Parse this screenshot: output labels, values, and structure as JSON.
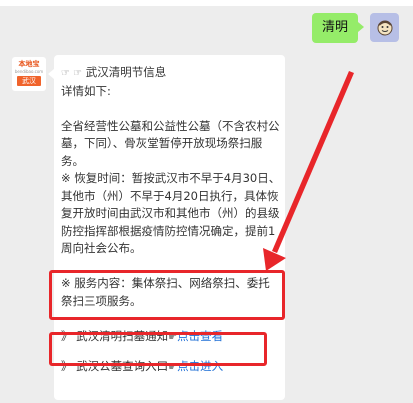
{
  "chat": {
    "outgoing": {
      "text": "清明"
    },
    "incoming": {
      "avatar": {
        "brand": "本地宝",
        "subtitle": "bendibao.com",
        "city": "武汉"
      },
      "title_prefix": "☞ ☞",
      "title": "武汉清明节信息",
      "intro": "详情如下:",
      "paragraph1": "全省经营性公墓和公益性公墓（不含农村公墓，下同）、骨灰堂暂停开放现场祭扫服务。",
      "paragraph2": "※ 恢复时间：暂按武汉市不早于4月30日、其他市（州）不早于4月20日执行，具体恢复开放时间由武汉市和其他市（州）的县级防控指挥部根据疫情防控情况确定，提前1周向社会公布。",
      "service": "※ 服务内容：集体祭扫、网络祭扫、委托祭扫三项服务。",
      "link1": {
        "prefix": "》",
        "text": "武汉清明扫墓通知",
        "hand": "☛",
        "action": "点击查看"
      },
      "link2": {
        "prefix": "》",
        "text": "武汉公墓查询入口",
        "hand": "☛",
        "action": "点击进入"
      }
    }
  },
  "colors": {
    "outgoing_bubble": "#95ec69",
    "highlight": "#e8262a",
    "link": "#1f6fd6"
  }
}
